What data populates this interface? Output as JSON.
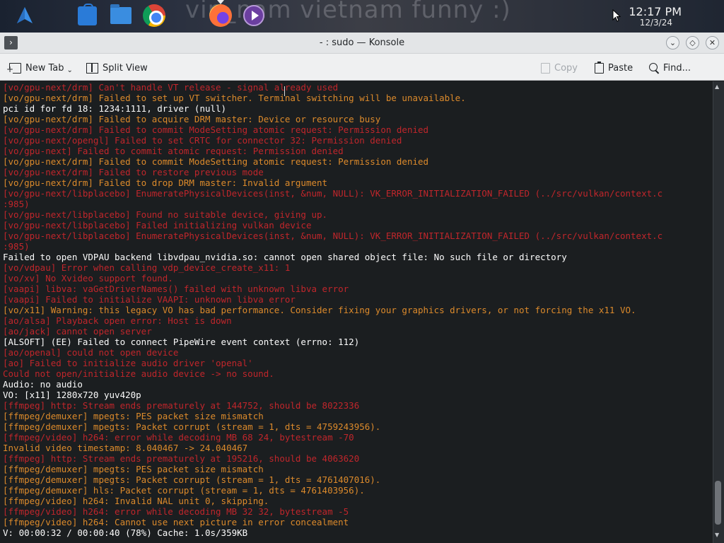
{
  "taskbar": {
    "wallpaper_text": "vin_nam vietnam funny :)",
    "clock_time": "12:17 PM",
    "clock_date": "12/3/24",
    "icons": [
      "launcher-icon",
      "store-icon",
      "files-icon",
      "chrome-icon",
      "firefox-icon",
      "media-player-icon"
    ]
  },
  "window": {
    "title": "- : sudo — Konsole",
    "menu_glyph": "›",
    "minimize_glyph": "⌄",
    "maximize_glyph": "◇",
    "close_glyph": "✕"
  },
  "toolbar": {
    "new_tab": "New Tab",
    "split_view": "Split View",
    "copy": "Copy",
    "paste": "Paste",
    "find": "Find...",
    "new_tab_chevron": "⌄"
  },
  "colors": {
    "terminal_bg": "#1b1e20",
    "error_red": "#c0262b",
    "warning_orange": "#dc8a2b",
    "normal_white": "#fcfcfc"
  },
  "terminal": {
    "lines": [
      {
        "text": "[vo/gpu-next/drm] Can't handle VT release - signal already used",
        "color": "red"
      },
      {
        "text": "[vo/gpu-next/drm] Failed to set up VT switcher. Terminal switching will be unavailable.",
        "color": "orange"
      },
      {
        "text": "pci id for fd 18: 1234:1111, driver (null)",
        "color": "white"
      },
      {
        "text": "[vo/gpu-next/drm] Failed to acquire DRM master: Device or resource busy",
        "color": "orange"
      },
      {
        "text": "[vo/gpu-next/drm] Failed to commit ModeSetting atomic request: Permission denied",
        "color": "red"
      },
      {
        "text": "[vo/gpu-next/opengl] Failed to set CRTC for connector 32: Permission denied",
        "color": "red"
      },
      {
        "text": "[vo/gpu-next] Failed to commit atomic request: Permission denied",
        "color": "red"
      },
      {
        "text": "[vo/gpu-next/drm] Failed to commit ModeSetting atomic request: Permission denied",
        "color": "orange"
      },
      {
        "text": "[vo/gpu-next/drm] Failed to restore previous mode",
        "color": "red"
      },
      {
        "text": "[vo/gpu-next/drm] Failed to drop DRM master: Invalid argument",
        "color": "orange"
      },
      {
        "text": "[vo/gpu-next/libplacebo] EnumeratePhysicalDevices(inst, &num, NULL): VK_ERROR_INITIALIZATION_FAILED (../src/vulkan/context.c",
        "color": "red"
      },
      {
        "text": ":985)",
        "color": "red"
      },
      {
        "text": "[vo/gpu-next/libplacebo] Found no suitable device, giving up.",
        "color": "red"
      },
      {
        "text": "[vo/gpu-next/libplacebo] Failed initializing vulkan device",
        "color": "red"
      },
      {
        "text": "[vo/gpu-next/libplacebo] EnumeratePhysicalDevices(inst, &num, NULL): VK_ERROR_INITIALIZATION_FAILED (../src/vulkan/context.c",
        "color": "red"
      },
      {
        "text": ":985)",
        "color": "red"
      },
      {
        "text": "Failed to open VDPAU backend libvdpau_nvidia.so: cannot open shared object file: No such file or directory",
        "color": "white"
      },
      {
        "text": "[vo/vdpau] Error when calling vdp_device_create_x11: 1",
        "color": "red"
      },
      {
        "text": "[vo/xv] No Xvideo support found.",
        "color": "red"
      },
      {
        "text": "[vaapi] libva: vaGetDriverNames() failed with unknown libva error",
        "color": "red"
      },
      {
        "text": "[vaapi] Failed to initialize VAAPI: unknown libva error",
        "color": "red"
      },
      {
        "text": "[vo/x11] Warning: this legacy VO has bad performance. Consider fixing your graphics drivers, or not forcing the x11 VO.",
        "color": "orange"
      },
      {
        "text": "[ao/alsa] Playback open error: Host is down",
        "color": "red"
      },
      {
        "text": "[ao/jack] cannot open server",
        "color": "red"
      },
      {
        "text": "[ALSOFT] (EE) Failed to connect PipeWire event context (errno: 112)",
        "color": "white"
      },
      {
        "text": "[ao/openal] could not open device",
        "color": "red"
      },
      {
        "text": "[ao] Failed to initialize audio driver 'openal'",
        "color": "red"
      },
      {
        "text": "Could not open/initialize audio device -> no sound.",
        "color": "red"
      },
      {
        "text": "Audio: no audio",
        "color": "white"
      },
      {
        "text": "VO: [x11] 1280x720 yuv420p",
        "color": "white"
      },
      {
        "text": "[ffmpeg] http: Stream ends prematurely at 144752, should be 8022336",
        "color": "red"
      },
      {
        "text": "[ffmpeg/demuxer] mpegts: PES packet size mismatch",
        "color": "orange"
      },
      {
        "text": "[ffmpeg/demuxer] mpegts: Packet corrupt (stream = 1, dts = 4759243956).",
        "color": "orange"
      },
      {
        "text": "[ffmpeg/video] h264: error while decoding MB 68 24, bytestream -70",
        "color": "red"
      },
      {
        "text": "Invalid video timestamp: 8.040467 -> 24.040467",
        "color": "orange"
      },
      {
        "text": "[ffmpeg] http: Stream ends prematurely at 195216, should be 4063620",
        "color": "red"
      },
      {
        "text": "[ffmpeg/demuxer] mpegts: PES packet size mismatch",
        "color": "orange"
      },
      {
        "text": "[ffmpeg/demuxer] mpegts: Packet corrupt (stream = 1, dts = 4761407016).",
        "color": "orange"
      },
      {
        "text": "[ffmpeg/demuxer] hls: Packet corrupt (stream = 1, dts = 4761403956).",
        "color": "orange"
      },
      {
        "text": "[ffmpeg/video] h264: Invalid NAL unit 0, skipping.",
        "color": "orange"
      },
      {
        "text": "[ffmpeg/video] h264: error while decoding MB 32 32, bytestream -5",
        "color": "red"
      },
      {
        "text": "[ffmpeg/video] h264: Cannot use next picture in error concealment",
        "color": "orange"
      },
      {
        "text": "V: 00:00:32 / 00:00:40 (78%) Cache: 1.0s/359KB",
        "color": "white"
      }
    ]
  },
  "scrollbar": {
    "up_glyph": "▲",
    "down_glyph": "▼"
  }
}
